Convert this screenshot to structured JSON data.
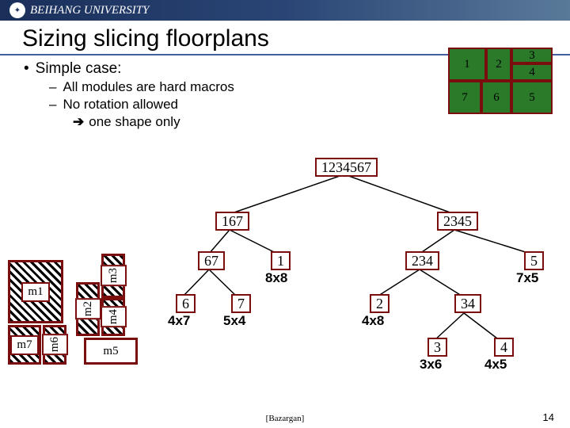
{
  "university": "BEIHANG UNIVERSITY",
  "slide_title": "Sizing slicing floorplans",
  "bullets": {
    "l1": "Simple case:",
    "l2a": "All modules are hard macros",
    "l2b": "No rotation allowed",
    "l3": "one shape only"
  },
  "fp_small": {
    "b1": "1",
    "b2": "2",
    "b3": "3",
    "b4": "4",
    "b5": "5",
    "b6": "6",
    "b7": "7"
  },
  "tree": {
    "root": "1234567",
    "n167": "167",
    "n2345": "2345",
    "n67": "67",
    "n1": "1",
    "dim1": "8x8",
    "n234": "234",
    "n5": "5",
    "dim5": "7x5",
    "n6": "6",
    "dim6": "4x7",
    "n7": "7",
    "dim7": "5x4",
    "n2": "2",
    "dim2": "4x8",
    "n34": "34",
    "n3": "3",
    "dim3": "3x6",
    "n4": "4",
    "dim4": "4x5"
  },
  "mods": {
    "m1": "m1",
    "m2": "m2",
    "m3": "m3",
    "m4": "m4",
    "m5": "m5",
    "m6": "m6",
    "m7": "m7"
  },
  "citation": "[Bazargan]",
  "page_number": "14"
}
